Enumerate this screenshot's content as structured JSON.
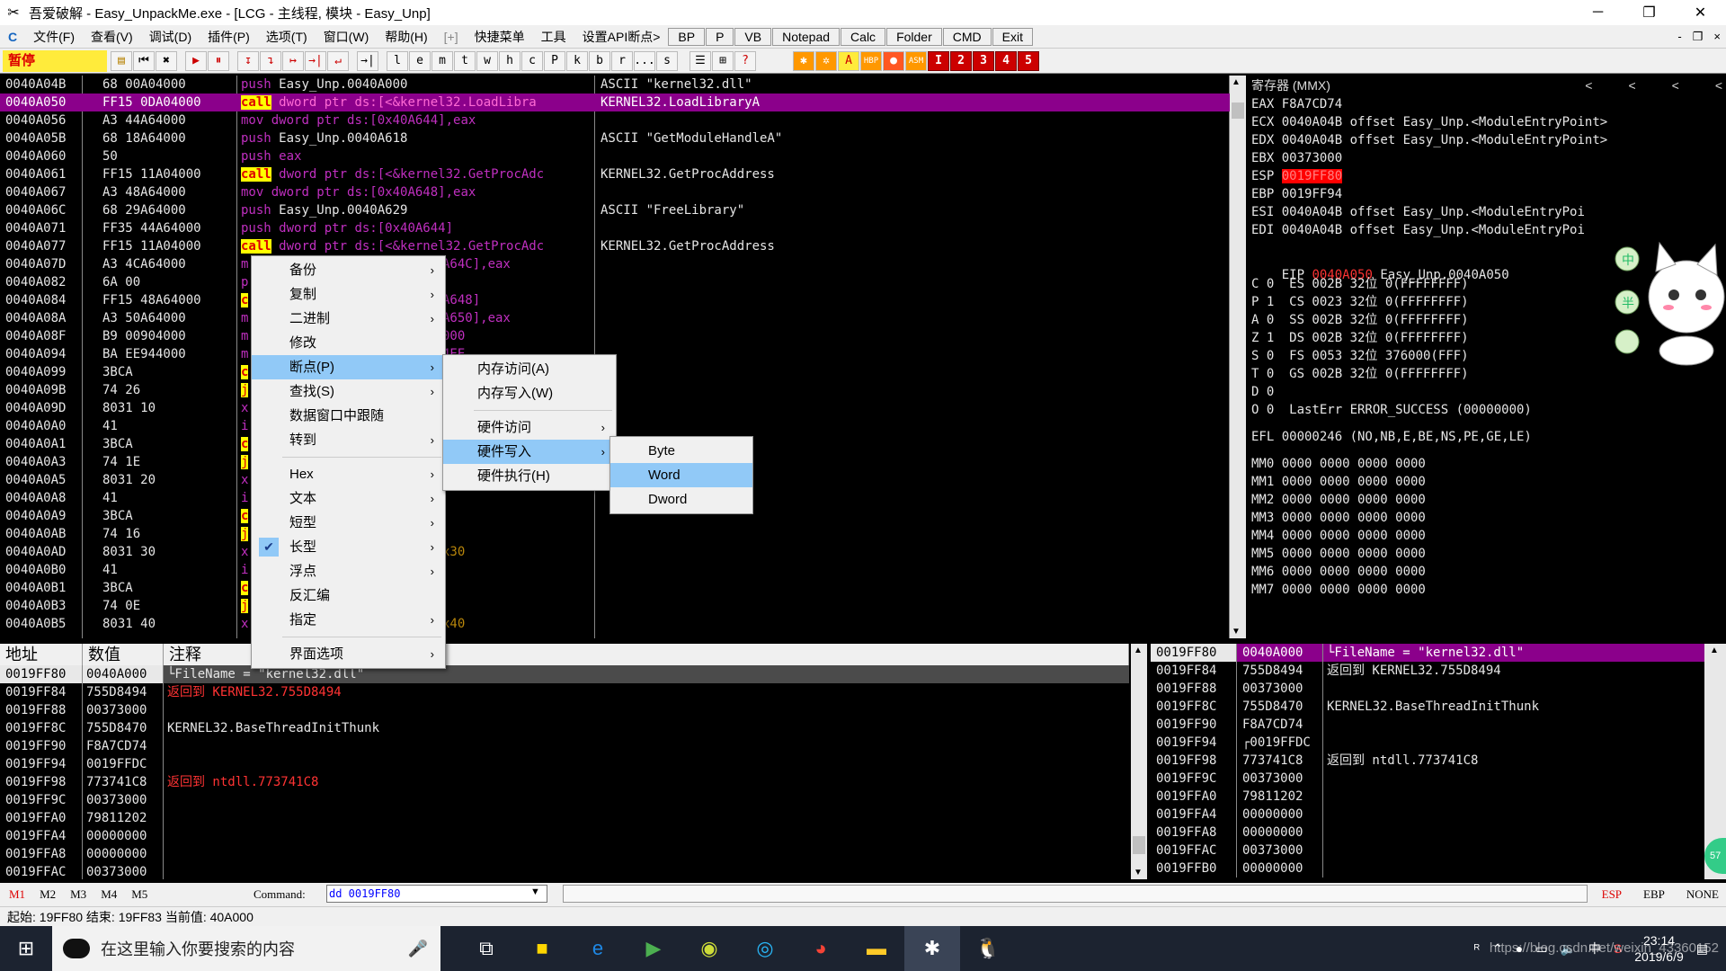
{
  "window": {
    "title": "吾爱破解 - Easy_UnpackMe.exe - [LCG - 主线程, 模块 - Easy_Unp]",
    "controls": [
      "─",
      "❐",
      "✕"
    ]
  },
  "menu": {
    "items": [
      "文件(F)",
      "查看(V)",
      "调试(D)",
      "插件(P)",
      "选项(T)",
      "窗口(W)",
      "帮助(H)",
      "[+]",
      "快捷菜单",
      "工具",
      "设置API断点>"
    ],
    "buttons": [
      "BP",
      "P",
      "VB",
      "Notepad",
      "Calc",
      "Folder",
      "CMD",
      "Exit"
    ],
    "mdi": [
      "-",
      "❐",
      "×"
    ]
  },
  "toolbar": {
    "status": "暂停",
    "buttons": [
      "▶",
      "⏸",
      "↧",
      "↴",
      "↦",
      "→|",
      "l",
      "e",
      "m",
      "t",
      "w",
      "h",
      "c",
      "P",
      "k",
      "b",
      "r",
      "...",
      "s",
      "☰",
      "⊞",
      "?"
    ],
    "plugin_buttons": [
      "1",
      "2",
      "3",
      "4",
      "5"
    ]
  },
  "cpu": {
    "rows": [
      {
        "addr": "0040A04B",
        "hex": "68 00A04000",
        "op": "push",
        "args": "Easy_Unp.0040A000",
        "comment": "ASCII \"kernel32.dll\"",
        "sel": false
      },
      {
        "addr": "0040A050",
        "hex": "FF15 0DA04000",
        "op": "call",
        "args": "dword ptr ds:[<&kernel32.LoadLibra",
        "comment": "KERNEL32.LoadLibraryA",
        "sel": true
      },
      {
        "addr": "0040A056",
        "hex": "A3 44A64000",
        "op": "mov",
        "args": "dword ptr ds:[0x40A644],eax",
        "comment": "",
        "sel": false
      },
      {
        "addr": "0040A05B",
        "hex": "68 18A64000",
        "op": "push",
        "args": "Easy_Unp.0040A618",
        "comment": "ASCII \"GetModuleHandleA\"",
        "sel": false
      },
      {
        "addr": "0040A060",
        "hex": "50",
        "op": "push",
        "args": "eax",
        "comment": "",
        "sel": false
      },
      {
        "addr": "0040A061",
        "hex": "FF15 11A04000",
        "op": "call",
        "args": "dword ptr ds:[<&kernel32.GetProcAdc",
        "comment": "KERNEL32.GetProcAddress",
        "sel": false
      },
      {
        "addr": "0040A067",
        "hex": "A3 48A64000",
        "op": "mov",
        "args": "dword ptr ds:[0x40A648],eax",
        "comment": "",
        "sel": false
      },
      {
        "addr": "0040A06C",
        "hex": "68 29A64000",
        "op": "push",
        "args": "Easy_Unp.0040A629",
        "comment": "ASCII \"FreeLibrary\"",
        "sel": false
      },
      {
        "addr": "0040A071",
        "hex": "FF35 44A64000",
        "op": "push",
        "args": "dword ptr ds:[0x40A644]",
        "comment": "",
        "sel": false
      },
      {
        "addr": "0040A077",
        "hex": "FF15 11A04000",
        "op": "call",
        "args": "dword ptr ds:[<&kernel32.GetProcAdc",
        "comment": "KERNEL32.GetProcAddress",
        "sel": false
      },
      {
        "addr": "0040A07D",
        "hex": "A3 4CA64000",
        "op": "m",
        "args": "",
        "tail": "A64C],eax",
        "comment": "",
        "sel": false
      },
      {
        "addr": "0040A082",
        "hex": "6A 00",
        "op": "p",
        "args": "",
        "tail": "",
        "comment": "",
        "sel": false
      },
      {
        "addr": "0040A084",
        "hex": "FF15 48A64000",
        "op": "c",
        "args": "",
        "tail": "A648]",
        "comment": "",
        "sel": false
      },
      {
        "addr": "0040A08A",
        "hex": "A3 50A64000",
        "op": "m",
        "args": "",
        "tail": "A650],eax",
        "comment": "",
        "sel": false
      },
      {
        "addr": "0040A08F",
        "hex": "B9 00904000",
        "op": "m",
        "args": "",
        "tail": "000",
        "comment": "",
        "sel": false
      },
      {
        "addr": "0040A094",
        "hex": "BA EE944000",
        "op": "m",
        "args": "",
        "tail": "4EE",
        "comment": "",
        "sel": false
      },
      {
        "addr": "0040A099",
        "hex": "3BCA",
        "op": "c",
        "args": "",
        "tail": "",
        "comment": "",
        "sel": false
      },
      {
        "addr": "0040A09B",
        "hex": "74 26",
        "op": "j",
        "args": "",
        "tail": "",
        "comment": "",
        "sel": false
      },
      {
        "addr": "0040A09D",
        "hex": "8031 10",
        "op": "x",
        "args": "",
        "tail": "",
        "comment": "",
        "sel": false
      },
      {
        "addr": "0040A0A0",
        "hex": "41",
        "op": "i",
        "args": "",
        "tail": "",
        "comment": "",
        "sel": false
      },
      {
        "addr": "0040A0A1",
        "hex": "3BCA",
        "op": "c",
        "args": "",
        "tail": "",
        "comment": "",
        "sel": false
      },
      {
        "addr": "0040A0A3",
        "hex": "74 1E",
        "op": "j",
        "args": "",
        "tail": "",
        "comment": "",
        "sel": false
      },
      {
        "addr": "0040A0A5",
        "hex": "8031 20",
        "op": "x",
        "args": "",
        "tail": "",
        "comment": "",
        "sel": false
      },
      {
        "addr": "0040A0A8",
        "hex": "41",
        "op": "i",
        "args": "",
        "tail": "",
        "comment": "",
        "sel": false
      },
      {
        "addr": "0040A0A9",
        "hex": "3BCA",
        "op": "c",
        "args": "",
        "tail": "",
        "comment": "",
        "sel": false
      },
      {
        "addr": "0040A0AB",
        "hex": "74 16",
        "op": "j",
        "args": "",
        "tail": "",
        "comment": "",
        "sel": false
      },
      {
        "addr": "0040A0AD",
        "hex": "8031 30",
        "op": "x",
        "args": "",
        "tail": "x30",
        "comment": "",
        "sel": false
      },
      {
        "addr": "0040A0B0",
        "hex": "41",
        "op": "i",
        "args": "",
        "tail": "",
        "comment": "",
        "sel": false
      },
      {
        "addr": "0040A0B1",
        "hex": "3BCA",
        "op": "c",
        "args": "",
        "tail": "",
        "comment": "",
        "sel": false
      },
      {
        "addr": "0040A0B3",
        "hex": "74 0E",
        "op": "j",
        "args": "",
        "tail": "",
        "comment": "",
        "sel": false
      },
      {
        "addr": "0040A0B5",
        "hex": "8031 40",
        "op": "x",
        "args": "",
        "tail": "x40",
        "comment": "",
        "sel": false
      }
    ]
  },
  "registers": {
    "header": "寄存器 (MMX)",
    "nav": [
      "<",
      "<",
      "<",
      "<"
    ],
    "gp": [
      {
        "name": "EAX",
        "val": "F8A7CD74",
        "comment": ""
      },
      {
        "name": "ECX",
        "val": "0040A04B",
        "comment": "offset Easy_Unp.<ModuleEntryPoint>"
      },
      {
        "name": "EDX",
        "val": "0040A04B",
        "comment": "offset Easy_Unp.<ModuleEntryPoint>"
      },
      {
        "name": "EBX",
        "val": "00373000",
        "comment": ""
      },
      {
        "name": "ESP",
        "val": "0019FF80",
        "comment": "",
        "hl": true
      },
      {
        "name": "EBP",
        "val": "0019FF94",
        "comment": ""
      },
      {
        "name": "ESI",
        "val": "0040A04B",
        "comment": "offset Easy_Unp.<ModuleEntryPoi"
      },
      {
        "name": "EDI",
        "val": "0040A04B",
        "comment": "offset Easy_Unp.<ModuleEntryPoi"
      }
    ],
    "eip": {
      "name": "EIP",
      "val": "0040A050",
      "comment": "Easy_Unp.0040A050"
    },
    "flags": [
      "C 0  ES 002B 32位 0(FFFFFFFF)",
      "P 1  CS 0023 32位 0(FFFFFFFF)",
      "A 0  SS 002B 32位 0(FFFFFFFF)",
      "Z 1  DS 002B 32位 0(FFFFFFFF)",
      "S 0  FS 0053 32位 376000(FFF)",
      "T 0  GS 002B 32位 0(FFFFFFFF)",
      "D 0",
      "O 0  LastErr ERROR_SUCCESS (00000000)"
    ],
    "efl": "EFL 00000246 (NO,NB,E,BE,NS,PE,GE,LE)",
    "mmx": [
      "MM0 0000 0000 0000 0000",
      "MM1 0000 0000 0000 0000",
      "MM2 0000 0000 0000 0000",
      "MM3 0000 0000 0000 0000",
      "MM4 0000 0000 0000 0000",
      "MM5 0000 0000 0000 0000",
      "MM6 0000 0000 0000 0000",
      "MM7 0000 0000 0000 0000"
    ]
  },
  "dump": {
    "headers": [
      "地址",
      "数值",
      "注释"
    ],
    "rows": [
      {
        "addr": "0019FF80",
        "val": "0040A000",
        "comment": "└FileName = \"kernel32.dll\"",
        "red": false,
        "hl": true
      },
      {
        "addr": "0019FF84",
        "val": "755D8494",
        "comment": "返回到 KERNEL32.755D8494",
        "red": true,
        "hl": false
      },
      {
        "addr": "0019FF88",
        "val": "00373000",
        "comment": "",
        "red": false,
        "hl": false
      },
      {
        "addr": "0019FF8C",
        "val": "755D8470",
        "comment": "KERNEL32.BaseThreadInitThunk",
        "red": false,
        "hl": false
      },
      {
        "addr": "0019FF90",
        "val": "F8A7CD74",
        "comment": "",
        "red": false,
        "hl": false
      },
      {
        "addr": "0019FF94",
        "val": "0019FFDC",
        "comment": "",
        "red": false,
        "hl": false
      },
      {
        "addr": "0019FF98",
        "val": "773741C8",
        "comment": "返回到 ntdll.773741C8",
        "red": true,
        "hl": false
      },
      {
        "addr": "0019FF9C",
        "val": "00373000",
        "comment": "",
        "red": false,
        "hl": false
      },
      {
        "addr": "0019FFA0",
        "val": "79811202",
        "comment": "",
        "red": false,
        "hl": false
      },
      {
        "addr": "0019FFA4",
        "val": "00000000",
        "comment": "",
        "red": false,
        "hl": false
      },
      {
        "addr": "0019FFA8",
        "val": "00000000",
        "comment": "",
        "red": false,
        "hl": false
      },
      {
        "addr": "0019FFAC",
        "val": "00373000",
        "comment": "",
        "red": false,
        "hl": false
      }
    ]
  },
  "stack": {
    "rows": [
      {
        "addr": "0019FF80",
        "val": "0040A000",
        "comment": "└FileName = \"kernel32.dll\"",
        "hl": true
      },
      {
        "addr": "0019FF84",
        "val": "755D8494",
        "comment": "返回到 KERNEL32.755D8494",
        "hl": false
      },
      {
        "addr": "0019FF88",
        "val": "00373000",
        "comment": "",
        "hl": false
      },
      {
        "addr": "0019FF8C",
        "val": "755D8470",
        "comment": "KERNEL32.BaseThreadInitThunk",
        "hl": false
      },
      {
        "addr": "0019FF90",
        "val": "F8A7CD74",
        "comment": "",
        "hl": false
      },
      {
        "addr": "0019FF94",
        "val": "┌0019FFDC",
        "comment": "",
        "hl": false
      },
      {
        "addr": "0019FF98",
        "val": "773741C8",
        "comment": "返回到 ntdll.773741C8",
        "hl": false
      },
      {
        "addr": "0019FF9C",
        "val": "00373000",
        "comment": "",
        "hl": false
      },
      {
        "addr": "0019FFA0",
        "val": "79811202",
        "comment": "",
        "hl": false
      },
      {
        "addr": "0019FFA4",
        "val": "00000000",
        "comment": "",
        "hl": false
      },
      {
        "addr": "0019FFA8",
        "val": "00000000",
        "comment": "",
        "hl": false
      },
      {
        "addr": "0019FFAC",
        "val": "00373000",
        "comment": "",
        "hl": false
      },
      {
        "addr": "0019FFB0",
        "val": "00000000",
        "comment": "",
        "hl": false
      }
    ]
  },
  "command": {
    "tabs": [
      "M1",
      "M2",
      "M3",
      "M4",
      "M5"
    ],
    "label": "Command:",
    "value": "dd 0019FF80",
    "right": [
      "ESP",
      "EBP",
      "NONE"
    ]
  },
  "status": "起始: 19FF80 结束: 19FF83 当前值: 40A000",
  "context_menu": {
    "items": [
      {
        "label": "备份",
        "sub": true
      },
      {
        "label": "复制",
        "sub": true
      },
      {
        "label": "二进制",
        "sub": true
      },
      {
        "label": "修改",
        "sub": false
      },
      {
        "label": "断点(P)",
        "sub": true,
        "sel": true
      },
      {
        "label": "查找(S)",
        "sub": true
      },
      {
        "label": "数据窗口中跟随",
        "sub": false
      },
      {
        "label": "转到",
        "sub": true
      },
      {
        "sep": true
      },
      {
        "label": "Hex",
        "sub": true
      },
      {
        "label": "文本",
        "sub": true
      },
      {
        "label": "短型",
        "sub": true
      },
      {
        "label": "长型",
        "sub": true,
        "checked": true
      },
      {
        "label": "浮点",
        "sub": true
      },
      {
        "label": "反汇编",
        "sub": false
      },
      {
        "label": "指定",
        "sub": true
      },
      {
        "sep": true
      },
      {
        "label": "界面选项",
        "sub": true
      }
    ],
    "breakpoint_items": [
      {
        "label": "内存访问(A)",
        "sub": false
      },
      {
        "label": "内存写入(W)",
        "sub": false
      },
      {
        "sep": true
      },
      {
        "label": "硬件访问",
        "sub": true
      },
      {
        "label": "硬件写入",
        "sub": true,
        "sel": true
      },
      {
        "label": "硬件执行(H)",
        "sub": false
      }
    ],
    "size_items": [
      {
        "label": "Byte",
        "sel": false
      },
      {
        "label": "Word",
        "sel": true
      },
      {
        "label": "Dword",
        "sel": false
      }
    ]
  },
  "taskbar": {
    "search_placeholder": "在这里输入你要搜索的内容",
    "apps": [
      "task-view",
      "sticky-notes",
      "edge",
      "media-player",
      "app-green",
      "chat",
      "chrome",
      "file-explorer",
      "debugger",
      "qq"
    ],
    "time": "23:14",
    "date": "2019/6/9",
    "watermark": "https://blog.csdn.net/weixin_43360152",
    "badge": "57"
  }
}
